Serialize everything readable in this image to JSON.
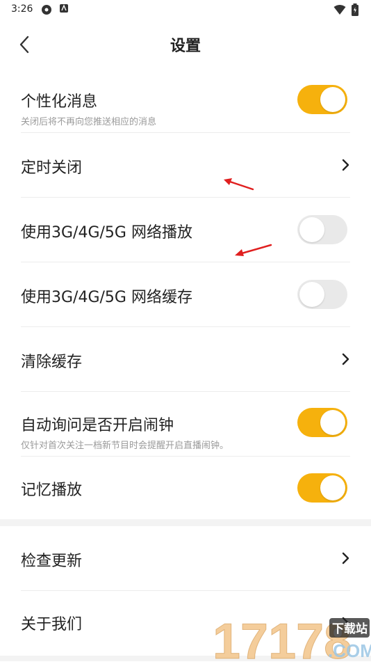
{
  "status_bar": {
    "time": "3:26",
    "icons": [
      "android-system-icon",
      "app-notification-icon",
      "wifi-icon",
      "battery-icon"
    ]
  },
  "header": {
    "title": "设置",
    "back_icon": "chevron-left-icon"
  },
  "settings": {
    "personalized_message": {
      "label": "个性化消息",
      "sublabel": "关闭后将不再向您推送相应的消息",
      "enabled": true
    },
    "timer_close": {
      "label": "定时关闭"
    },
    "mobile_play": {
      "label": "使用3G/4G/5G 网络播放",
      "enabled": false
    },
    "mobile_cache": {
      "label": "使用3G/4G/5G 网络缓存",
      "enabled": false
    },
    "clear_cache": {
      "label": "清除缓存"
    },
    "auto_alarm": {
      "label": "自动询问是否开启闹钟",
      "sublabel": "仅针对首次关注一档新节目时会提醒开启直播闹钟。",
      "enabled": true
    },
    "memory_play": {
      "label": "记忆播放",
      "enabled": true
    },
    "check_update": {
      "label": "检查更新"
    },
    "about_us": {
      "label": "关于我们"
    }
  },
  "watermark": {
    "number": "17178",
    "tag": "下载站",
    "suffix": ".COM"
  },
  "colors": {
    "accent": "#f6b10d",
    "toggle_off": "#e9e9e9",
    "divider": "#ececec",
    "section_gap": "#f3f3f3",
    "annotation_arrow": "#e01f1f"
  }
}
